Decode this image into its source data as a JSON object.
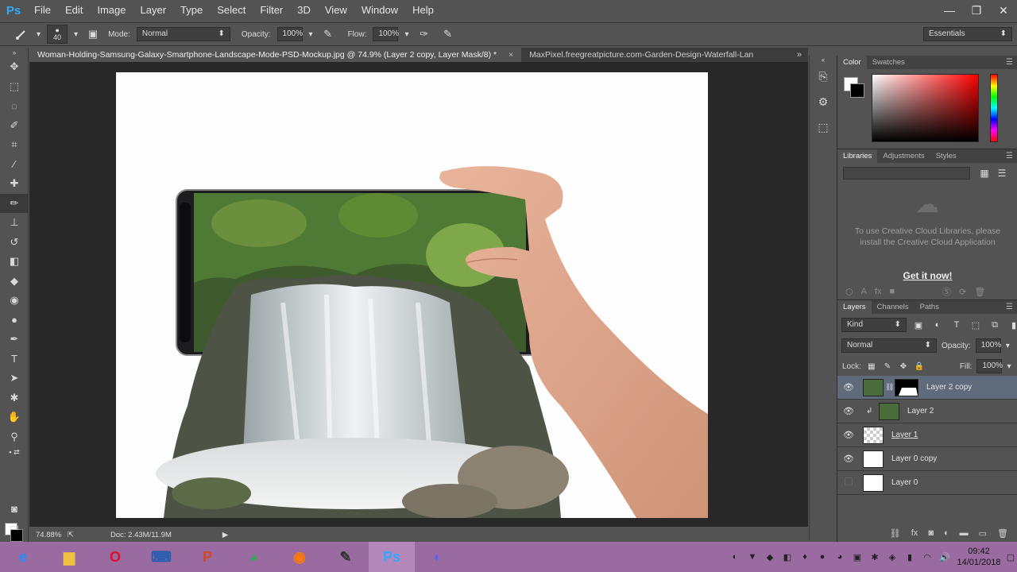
{
  "app": {
    "logo": "Ps"
  },
  "menu": [
    "File",
    "Edit",
    "Image",
    "Layer",
    "Type",
    "Select",
    "Filter",
    "3D",
    "View",
    "Window",
    "Help"
  ],
  "window_controls": [
    "—",
    "❐",
    "✕"
  ],
  "options": {
    "brush_size": "40",
    "mode_label": "Mode:",
    "mode_value": "Normal",
    "opacity_label": "Opacity:",
    "opacity_value": "100%",
    "flow_label": "Flow:",
    "flow_value": "100%",
    "workspace": "Essentials"
  },
  "tabs": [
    {
      "label": "Woman-Holding-Samsung-Galaxy-Smartphone-Landscape-Mode-PSD-Mockup.jpg @ 74.9% (Layer 2 copy, Layer Mask/8) *",
      "close": "×"
    },
    {
      "label": "MaxPixel.freegreatpicture.com-Garden-Design-Waterfall-Lan"
    }
  ],
  "tabs_more": "»",
  "status": {
    "zoom": "74.88%",
    "doc": "Doc: 2.43M/11.9M"
  },
  "color_panel": {
    "tabs": [
      "Color",
      "Swatches"
    ],
    "fg": "#ffffff",
    "bg": "#000000"
  },
  "libraries_panel": {
    "tabs": [
      "Libraries",
      "Adjustments",
      "Styles"
    ],
    "message": "To use Creative Cloud Libraries, please install the Creative Cloud Application",
    "cta": "Get it now!"
  },
  "layers_panel": {
    "tabs": [
      "Layers",
      "Channels",
      "Paths"
    ],
    "kind": "Kind",
    "blend_mode": "Normal",
    "opacity_label": "Opacity:",
    "opacity_value": "100%",
    "lock_label": "Lock:",
    "fill_label": "Fill:",
    "fill_value": "100%",
    "layers": [
      {
        "name": "Layer 2 copy",
        "visible": true,
        "selected": true
      },
      {
        "name": "Layer 2",
        "visible": true,
        "selected": false
      },
      {
        "name": "Layer 1",
        "visible": true,
        "selected": false
      },
      {
        "name": "Layer 0 copy",
        "visible": true,
        "selected": false
      },
      {
        "name": "Layer 0",
        "visible": false,
        "selected": false
      }
    ]
  },
  "taskbar": {
    "time": "09:42",
    "date": "14/01/2018"
  },
  "colors": {
    "accent": "#31a8ff",
    "taskbar": "#9a6ba0",
    "panel": "#535353",
    "workspace": "#282828"
  }
}
